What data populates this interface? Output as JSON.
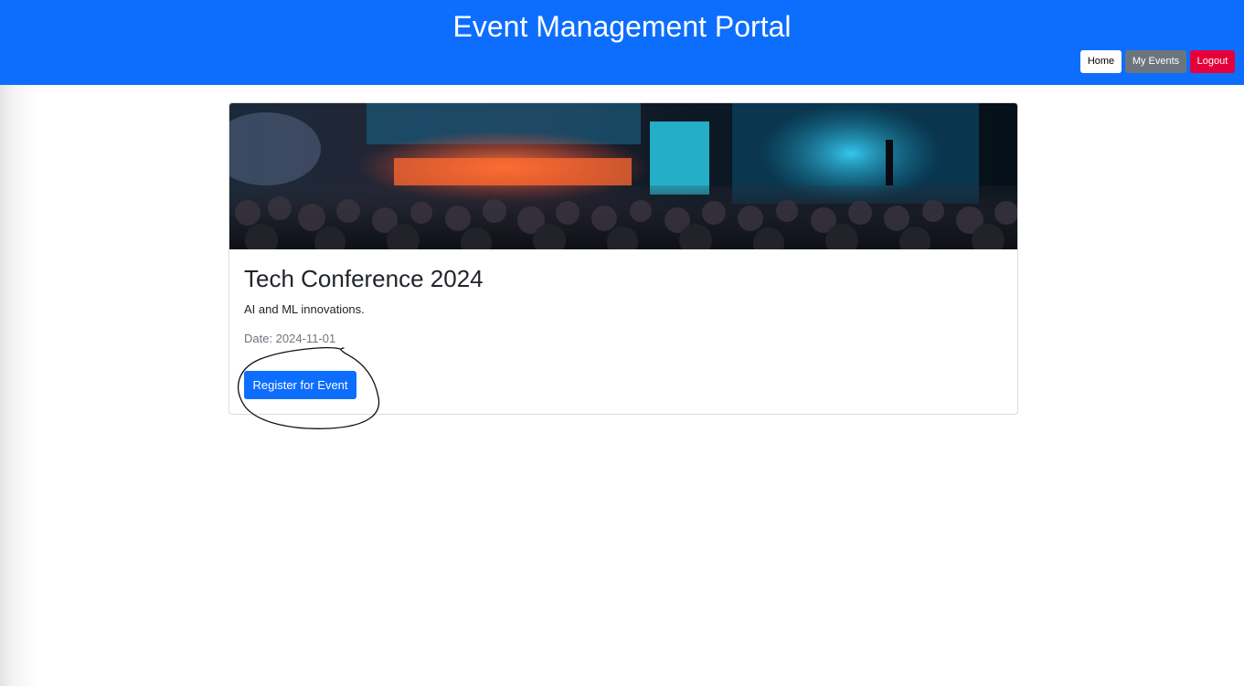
{
  "header": {
    "title": "Event Management Portal",
    "background_color": "#0d6efd"
  },
  "nav": {
    "home_label": "Home",
    "my_events_label": "My Events",
    "logout_label": "Logout"
  },
  "event_card": {
    "image_description_icon": "conference-photo",
    "title": "Tech Conference 2024",
    "description": "AI and ML innovations.",
    "date": "Date: 2024-11-01",
    "register_label": "Register for Event"
  },
  "colors": {
    "primary": "#0d6efd",
    "secondary": "#6c757d",
    "danger": "#e6003a"
  }
}
